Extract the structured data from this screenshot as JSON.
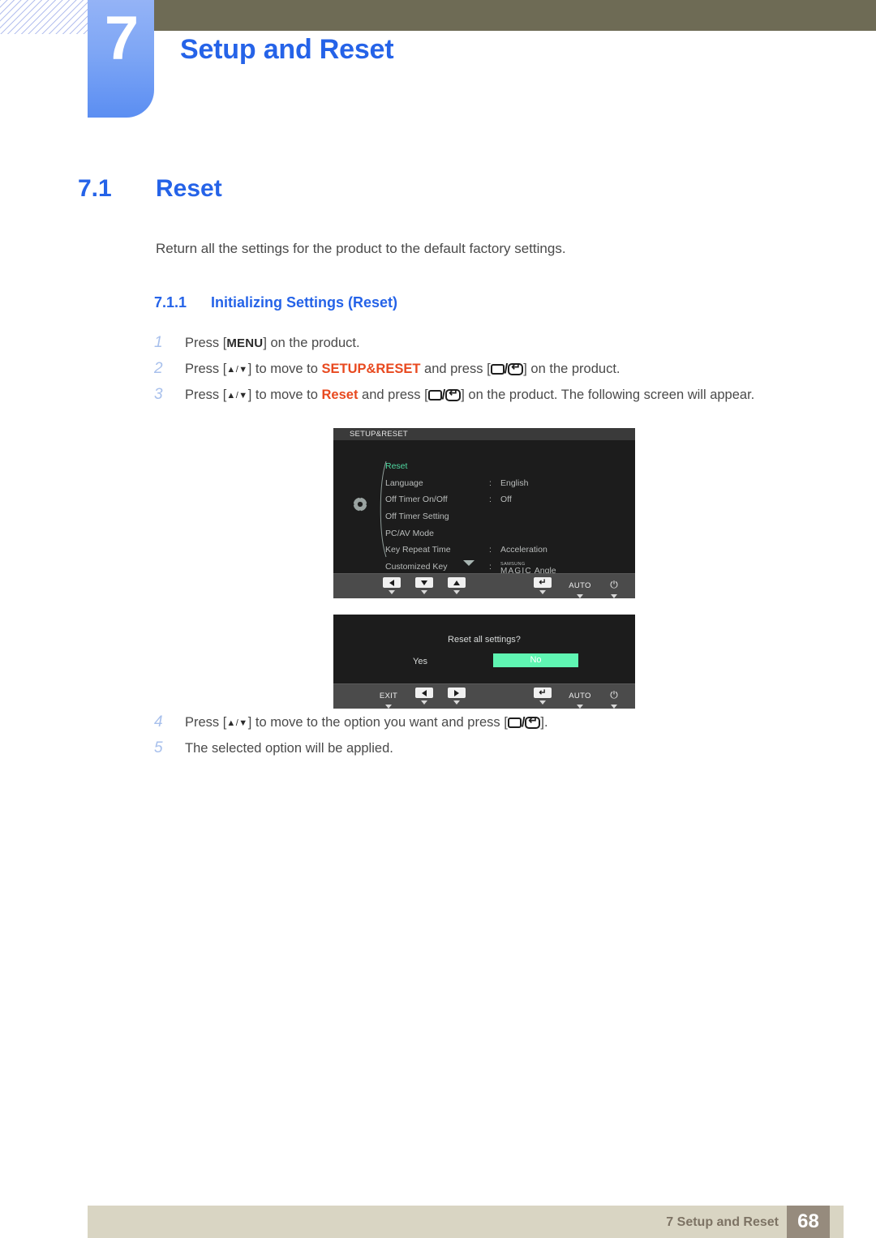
{
  "chapter": {
    "number": "7",
    "title": "Setup and Reset"
  },
  "section": {
    "number": "7.1",
    "title": "Reset",
    "intro": "Return all the settings for the product to the default factory settings."
  },
  "subsection": {
    "number": "7.1.1",
    "title": "Initializing Settings (Reset)"
  },
  "steps": [
    {
      "num": "1",
      "pre": "Press [",
      "menu_key": "MENU",
      "post": "] on the product."
    },
    {
      "num": "2",
      "pre": "Press [",
      "arrows": "▲/▼",
      "mid": "] to move to ",
      "highlight": "SETUP&RESET",
      "mid2": " and press [",
      "post": "] on the product."
    },
    {
      "num": "3",
      "pre": "Press [",
      "arrows": "▲/▼",
      "mid": "] to move to ",
      "highlight": "Reset",
      "mid2": " and press [",
      "post": "] on the product. The following screen will appear."
    },
    {
      "num": "4",
      "pre": "Press [",
      "arrows": "▲/▼",
      "mid": "] to move to the option you want and press [",
      "post": "]."
    },
    {
      "num": "5",
      "text": "The selected option will be applied."
    }
  ],
  "osd_menu": {
    "title": "SETUP&RESET",
    "icon": "gear-icon",
    "rows": [
      {
        "label": "Reset",
        "colon": "",
        "value": "",
        "selected": true
      },
      {
        "label": "Language",
        "colon": ":",
        "value": "English",
        "selected": false
      },
      {
        "label": "Off Timer On/Off",
        "colon": ":",
        "value": "Off",
        "selected": false
      },
      {
        "label": "Off Timer Setting",
        "colon": "",
        "value": "",
        "selected": false
      },
      {
        "label": "PC/AV Mode",
        "colon": "",
        "value": "",
        "selected": false
      },
      {
        "label": "Key Repeat Time",
        "colon": ":",
        "value": "Acceleration",
        "selected": false
      },
      {
        "label": "Customized Key",
        "colon": ":",
        "value": "",
        "selected": false,
        "magic": true
      }
    ],
    "magic_value": {
      "top": "SAMSUNG",
      "bottom": "MAGIC",
      "suffix": "Angle"
    },
    "buttons": [
      {
        "type": "tri-left",
        "label": ""
      },
      {
        "type": "tri-down",
        "label": ""
      },
      {
        "type": "tri-up",
        "label": ""
      },
      {
        "type": "enter",
        "label": ""
      },
      {
        "type": "text",
        "label": "AUTO"
      },
      {
        "type": "power",
        "label": "⏻"
      }
    ]
  },
  "osd_confirm": {
    "question": "Reset all settings?",
    "yes_label": "Yes",
    "no_label": "No",
    "highlight_color": "#5ff5b2",
    "buttons": [
      {
        "type": "text",
        "label": "EXIT"
      },
      {
        "type": "tri-left",
        "label": ""
      },
      {
        "type": "tri-right",
        "label": ""
      },
      {
        "type": "enter",
        "label": ""
      },
      {
        "type": "text",
        "label": "AUTO"
      },
      {
        "type": "power",
        "label": "⏻"
      }
    ]
  },
  "footer": {
    "text": "7 Setup and Reset",
    "page": "68"
  },
  "colors": {
    "accent_blue": "#2563e8",
    "chapter_tab": "#7ea6f5",
    "olive": "#6e6b55",
    "orange": "#e8491f",
    "footer_beige": "#d9d5c3",
    "footer_page_box": "#968b7d",
    "osd_background": "#1c1c1c",
    "osd_selected_green": "#4fd8a0"
  }
}
